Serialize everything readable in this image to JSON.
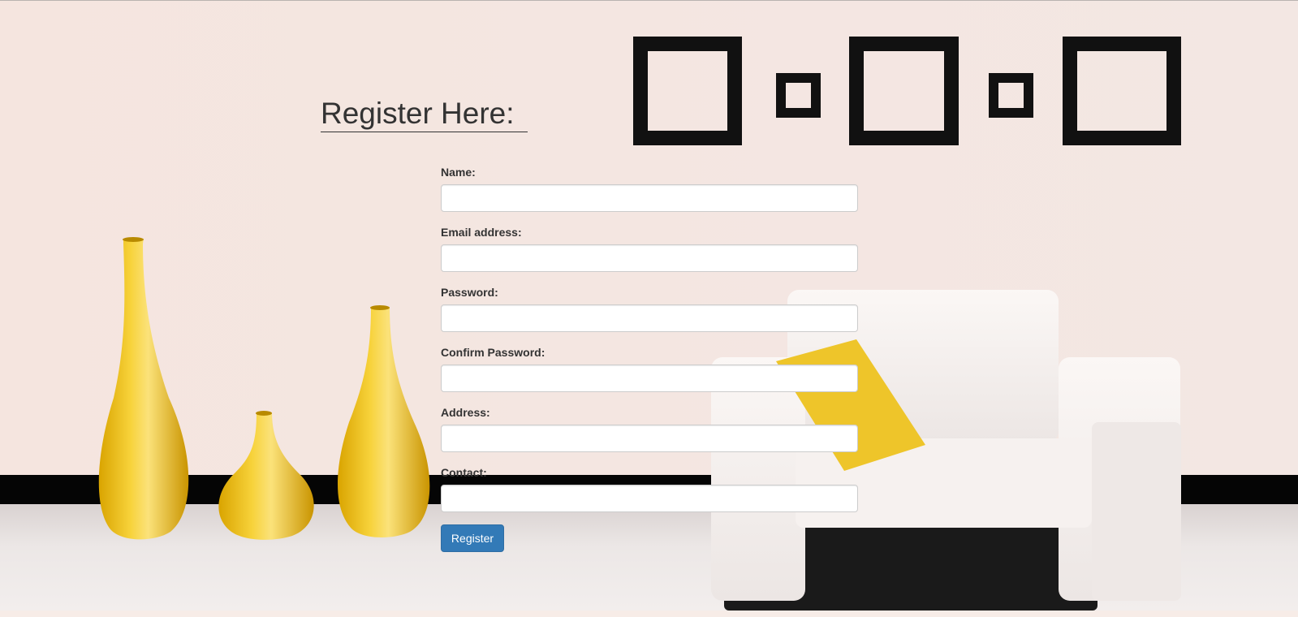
{
  "page": {
    "title": "Register Here:"
  },
  "form": {
    "fields": [
      {
        "label": "Name:",
        "value": "",
        "placeholder": ""
      },
      {
        "label": "Email address:",
        "value": "",
        "placeholder": ""
      },
      {
        "label": "Password:",
        "value": "",
        "placeholder": ""
      },
      {
        "label": "Confirm Password:",
        "value": "",
        "placeholder": ""
      },
      {
        "label": "Address:",
        "value": "",
        "placeholder": ""
      },
      {
        "label": "Contact:",
        "value": "",
        "placeholder": ""
      }
    ],
    "submit_label": "Register"
  },
  "colors": {
    "button": "#337ab7",
    "text": "#333333",
    "accent_yellow": "#f0c419"
  }
}
